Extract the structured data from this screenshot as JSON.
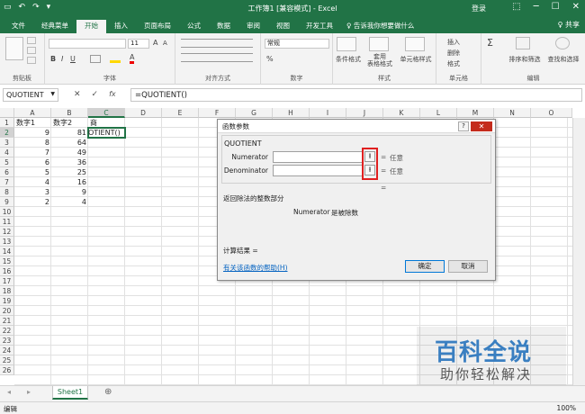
{
  "titlebar": {
    "title": "工作簿1 [兼容模式] - Excel",
    "login": "登录",
    "qat": [
      "↶",
      "↷",
      "▭",
      "▾"
    ],
    "win": [
      "⬚",
      "─",
      "☐",
      "✕"
    ]
  },
  "tabs": [
    {
      "label": "文件"
    },
    {
      "label": "经典菜单"
    },
    {
      "label": "开始",
      "active": true
    },
    {
      "label": "插入"
    },
    {
      "label": "页面布局"
    },
    {
      "label": "公式"
    },
    {
      "label": "数据"
    },
    {
      "label": "审阅"
    },
    {
      "label": "视图"
    },
    {
      "label": "开发工具"
    }
  ],
  "tell_me": "♀ 告诉我你想要做什么",
  "share": "♀ 共享",
  "ribbon": {
    "groups": [
      "剪贴板",
      "字体",
      "对齐方式",
      "数字",
      "样式",
      "单元格",
      "编辑"
    ],
    "font_size": "11",
    "number_format": "常规",
    "style_buttons": [
      "条件格式",
      "套用\n表格格式",
      "单元格样式"
    ],
    "cell_buttons": [
      "插入",
      "删除",
      "格式"
    ],
    "edit_buttons": [
      "Σ",
      "排序和筛选",
      "查找和选择"
    ]
  },
  "formula_bar": {
    "name_box": "QUOTIENT",
    "fx": "fx",
    "formula": "=QUOTIENT()"
  },
  "columns": [
    "A",
    "B",
    "C",
    "D",
    "E",
    "F",
    "G",
    "H",
    "I",
    "J",
    "K",
    "L",
    "M",
    "N",
    "O"
  ],
  "rows": [
    "1",
    "2",
    "3",
    "4",
    "5",
    "6",
    "7",
    "8",
    "9",
    "10",
    "11",
    "12",
    "13",
    "14",
    "15",
    "16",
    "17",
    "18",
    "19",
    "20",
    "21",
    "22",
    "23",
    "24",
    "25",
    "26"
  ],
  "cells": {
    "A1": "数字1",
    "B1": "数字2",
    "C1": "商",
    "A2": "9",
    "B2": "81",
    "C2": "OTIENT()",
    "A3": "8",
    "B3": "64",
    "A4": "7",
    "B4": "49",
    "A5": "6",
    "B5": "36",
    "A6": "5",
    "B6": "25",
    "A7": "4",
    "B7": "16",
    "A8": "3",
    "B8": "9",
    "A9": "2",
    "B9": "4"
  },
  "dialog": {
    "title": "函数参数",
    "function_name": "QUOTIENT",
    "arg1_label": "Numerator",
    "arg2_label": "Denominator",
    "eq": "=",
    "any": "任意",
    "description": "返回除法的整数部分",
    "arg_help_name": "Numerator",
    "arg_help_text": "是被除数",
    "result_label": "计算结果 =",
    "help_link": "有关该函数的帮助(H)",
    "ok": "确定",
    "cancel": "取消",
    "help_btn": "?",
    "close_btn": "✕"
  },
  "sheet": {
    "tab": "Sheet1",
    "add": "⊕",
    "nav_prev": "◂",
    "nav_next": "▸"
  },
  "status": {
    "mode": "编辑",
    "zoom": "100%"
  },
  "watermark": {
    "line1": "百科全说",
    "line2": "助你轻松解决"
  },
  "accent": "#217346"
}
